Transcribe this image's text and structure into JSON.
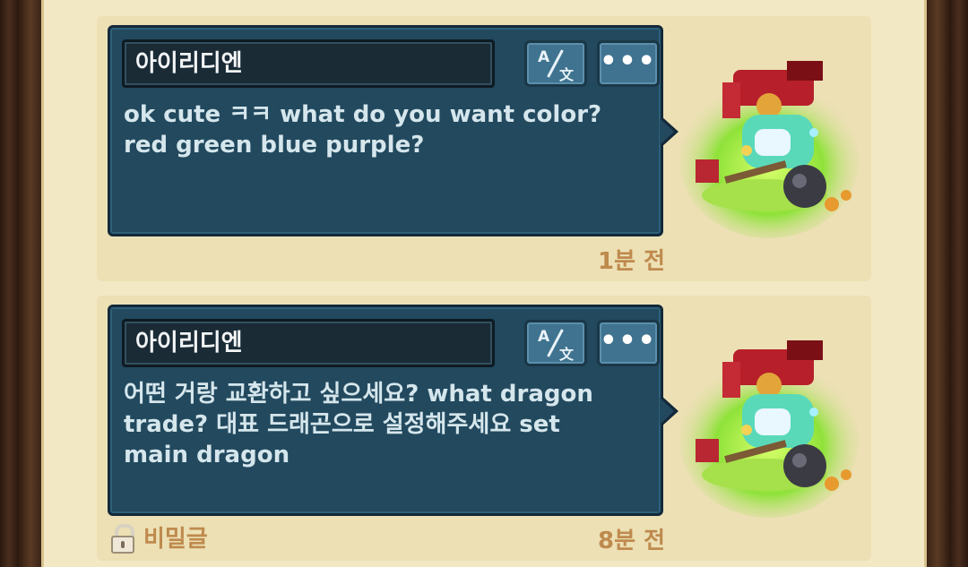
{
  "messages": [
    {
      "author": "아이리디엔",
      "translate_icon": "translate-icon",
      "translate_glyph_a": "A",
      "translate_glyph_b": "文",
      "more_label": "•••",
      "text": "ok cute ㅋㅋ what do you want color?\nred green blue purple?",
      "time": "1분 전",
      "avatar_icon": "dragon-avatar-icon"
    },
    {
      "author": "아이리디엔",
      "translate_icon": "translate-icon",
      "translate_glyph_a": "A",
      "translate_glyph_b": "文",
      "more_label": "•••",
      "text": "어떤 거랑 교환하고 싶으세요? what dragon\ntrade? 대표 드래곤으로 설정해주세요 set\nmain dragon",
      "time": "8분 전",
      "secret_label": "비밀글",
      "secret_icon": "lock-icon",
      "avatar_icon": "dragon-avatar-icon"
    }
  ],
  "colors": {
    "bubble": "#22495e",
    "name_box": "#1a2b36",
    "paper": "#f3e8c4",
    "accent_text": "#bf8a4e"
  }
}
